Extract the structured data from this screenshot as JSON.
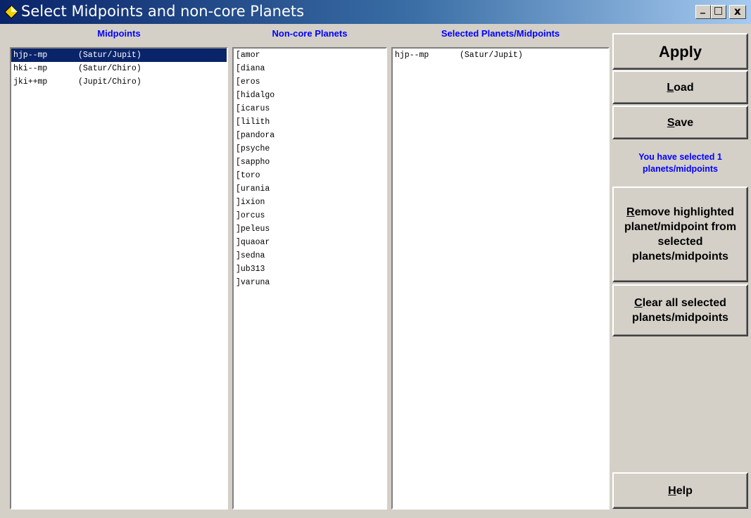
{
  "window": {
    "title": "Select Midpoints and non-core Planets",
    "minimize": "_",
    "maximize": "□",
    "close": "x"
  },
  "columns": {
    "midpoints_header": "Midpoints",
    "noncore_header": "Non-core Planets",
    "selected_header": "Selected Planets/Midpoints"
  },
  "midpoints": [
    {
      "code": "hjp--mp",
      "pair": "(Satur/Jupit)",
      "selected": true
    },
    {
      "code": "hki--mp",
      "pair": "(Satur/Chiro)",
      "selected": false
    },
    {
      "code": "jki++mp",
      "pair": "(Jupit/Chiro)",
      "selected": false
    }
  ],
  "noncore_planets": [
    "[amor",
    "[diana",
    "[eros",
    "[hidalgo",
    "[icarus",
    "[lilith",
    "[pandora",
    "[psyche",
    "[sappho",
    "[toro",
    "[urania",
    "]ixion",
    "]orcus",
    "]peleus",
    "]quaoar",
    "]sedna",
    "]ub313",
    "]varuna"
  ],
  "selected_items": [
    {
      "code": "hjp--mp",
      "pair": "(Satur/Jupit)"
    }
  ],
  "buttons": {
    "apply": "Apply",
    "load_mn": "L",
    "load_rest": "oad",
    "save_mn": "S",
    "save_rest": "ave",
    "remove_mn": "R",
    "remove_rest": "emove highlighted planet/midpoint from selected planets/midpoints",
    "clear_mn": "C",
    "clear_rest": "lear all selected planets/midpoints",
    "help_mn": "H",
    "help_rest": "elp"
  },
  "status": "You have selected 1 planets/midpoints",
  "colors": {
    "title_gradient_start": "#0a246a",
    "header_text": "#0000ff",
    "selection": "#0a246a",
    "face": "#d4d0c8"
  }
}
